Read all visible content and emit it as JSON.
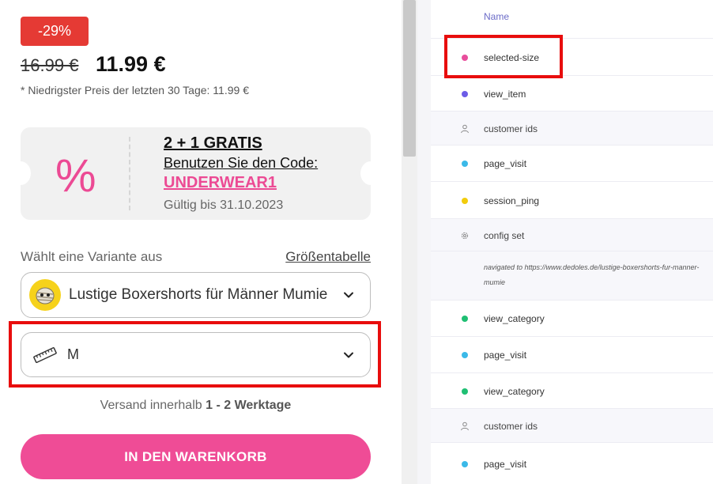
{
  "product": {
    "discount_badge": "-29%",
    "old_price": "16.99 €",
    "new_price": "11.99 €",
    "lowest_price_note": "* Niedrigster Preis der letzten 30 Tage: 11.99 €"
  },
  "coupon": {
    "symbol": "%",
    "title": "2 + 1 GRATIS",
    "use_code_text": "Benutzen Sie den Code:",
    "code": "UNDERWEAR1",
    "valid_until": "Gültig bis 31.10.2023"
  },
  "variant": {
    "label": "Wählt eine Variante aus",
    "size_chart_link": "Größentabelle",
    "design_value": "Lustige Boxershorts für Männer Mumie",
    "size_value": "M"
  },
  "shipping": {
    "prefix": "Versand innerhalb ",
    "days": "1 - 2 Werktage"
  },
  "cart_button": "IN DEN WARENKORB",
  "events_table": {
    "column_name": "Name",
    "rows": [
      {
        "label": "selected-size",
        "icon": "dot",
        "color": "#e84e9c"
      },
      {
        "label": "view_item",
        "icon": "dot",
        "color": "#6c5ce7"
      },
      {
        "label": "customer ids",
        "icon": "user-icon",
        "color": "#888888"
      },
      {
        "label": "page_visit",
        "icon": "dot",
        "color": "#3bb9e8"
      },
      {
        "label": "session_ping",
        "icon": "dot",
        "color": "#f2cc0c"
      },
      {
        "label": "config set",
        "icon": "gear-icon",
        "color": "#888888"
      },
      {
        "label": "navigated to https://www.dedoles.de/lustige-boxershorts-fur-manner-mumie",
        "icon": "none",
        "color": ""
      },
      {
        "label": "view_category",
        "icon": "dot",
        "color": "#1fbf73"
      },
      {
        "label": "page_visit",
        "icon": "dot",
        "color": "#3bb9e8"
      },
      {
        "label": "view_category",
        "icon": "dot",
        "color": "#1fbf73"
      },
      {
        "label": "customer ids",
        "icon": "user-icon",
        "color": "#888888"
      },
      {
        "label": "page_visit",
        "icon": "dot",
        "color": "#3bb9e8"
      }
    ]
  }
}
